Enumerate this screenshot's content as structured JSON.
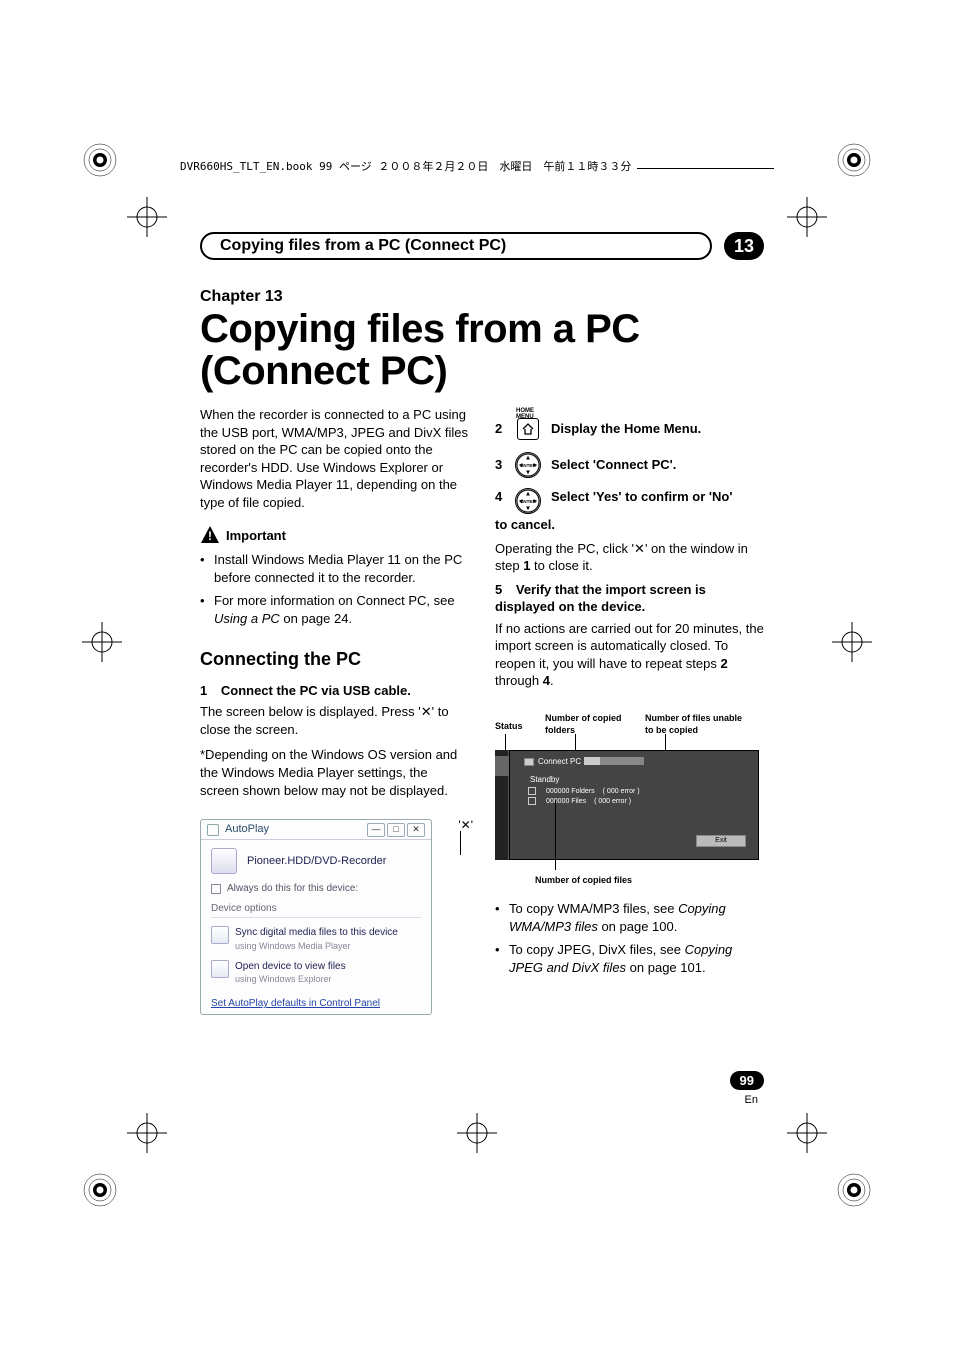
{
  "header_label": "DVR660HS_TLT_EN.book  99 ページ  ２００８年２月２０日　水曜日　午前１１時３３分",
  "chapter_bar_title": "Copying files from a PC (Connect PC)",
  "chapter_number": "13",
  "chapter_label": "Chapter 13",
  "big_title_l1": "Copying files from a PC",
  "big_title_l2": "(Connect PC)",
  "intro": "When the recorder is connected to a PC using the USB port, WMA/MP3, JPEG and DivX files stored on the PC can be copied onto the recorder's HDD. Use Windows Explorer or Windows Media Player 11, depending on the type of file copied.",
  "important_label": "Important",
  "important": {
    "b1": "Install Windows Media Player 11 on the PC before connected it to the recorder.",
    "b2_pre": "For more information on Connect PC, see ",
    "b2_ital": "Using a PC",
    "b2_post": " on page 24."
  },
  "connecting_heading": "Connecting the PC",
  "step1_no": "1",
  "step1_text": "Connect the PC via USB cable.",
  "step1_desc_pre": "The screen below is displayed. Press '",
  "step1_desc_x": "✕",
  "step1_desc_post": "' to close the screen.",
  "star_note": "*Depending on the Windows OS version and the Windows Media Player settings, the screen shown below may not be displayed.",
  "close_x_label": "'✕'",
  "autoplay": {
    "title": "AutoPlay",
    "device_name": "Pioneer.HDD/DVD-Recorder",
    "checkbox": "Always do this for this device:",
    "group": "Device options",
    "opt1_t": "Sync digital media files to this device",
    "opt1_s": "using Windows Media Player",
    "opt2_t": "Open device to view files",
    "opt2_s": "using Windows Explorer",
    "link": "Set AutoPlay defaults in Control Panel"
  },
  "home_menu_label": "HOME MENU",
  "step2_no": "2",
  "step2_text": "Display the Home Menu.",
  "step3_no": "3",
  "step3_text": "Select 'Connect PC'.",
  "step4_no": "4",
  "step4_text": "Select 'Yes' to confirm or 'No' to cancel.",
  "step4_cont": "to cancel.",
  "step4_desc_pre": "Operating the PC, click '",
  "step4_desc_x": "✕",
  "step4_desc_post": "' on the window in step ",
  "step4_desc_b1": "1",
  "step4_desc_end": " to close it.",
  "step5_no": "5",
  "step5_text": "Verify that the import screen is displayed on the device.",
  "step5_desc_p1": "If no actions are carried out for 20 minutes, the import screen is automatically closed. To reopen it, you will have to repeat steps ",
  "step5_desc_b2": "2",
  "step5_desc_mid": " through ",
  "step5_desc_b4": "4",
  "step5_desc_end": ".",
  "diagram": {
    "lbl_status": "Status",
    "lbl_copied_folders": "Number of copied folders",
    "lbl_unable": "Number of files unable to be copied",
    "lbl_copied_files": "Number of copied files",
    "screen_title": "Connect PC",
    "standby": "Standby",
    "row_folders": "000000 Folders",
    "row_folders_err": "( 000  error  )",
    "row_files": "000000 Files",
    "row_files_err": "( 000  error  )",
    "exit": "Exit"
  },
  "tail_bullets": {
    "b1_pre": "To copy WMA/MP3 files, see ",
    "b1_ital": "Copying WMA/MP3 files",
    "b1_post": " on page 100.",
    "b2_pre": "To copy JPEG, DivX files, see ",
    "b2_ital": "Copying JPEG and DivX files",
    "b2_post": " on page 101."
  },
  "enter_label": "ENTER",
  "page_number": "99",
  "lang": "En"
}
